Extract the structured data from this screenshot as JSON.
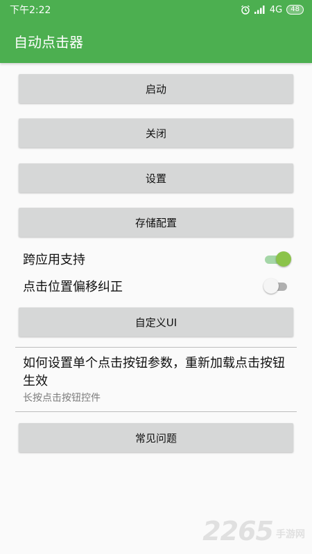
{
  "status_bar": {
    "time": "下午2:22",
    "network": "4G",
    "battery": "48",
    "icons": [
      "alarm-icon",
      "signal-icon",
      "battery-icon"
    ]
  },
  "app_bar": {
    "title": "自动点击器"
  },
  "buttons": {
    "start": "启动",
    "close": "关闭",
    "settings": "设置",
    "save_config": "存储配置",
    "custom_ui": "自定义UI",
    "faq": "常见问题"
  },
  "toggles": [
    {
      "label": "跨应用支持",
      "on": true
    },
    {
      "label": "点击位置偏移纠正",
      "on": false
    }
  ],
  "info": {
    "title": "如何设置单个点击按钮参数，重新加载点击按钮生效",
    "subtitle": "长按点击按钮控件"
  },
  "watermark": {
    "number": "2265",
    "text": "手游网"
  },
  "colors": {
    "primary": "#4caf50",
    "switch_on": "#8bc34a",
    "button_bg": "#d6d7d7"
  }
}
